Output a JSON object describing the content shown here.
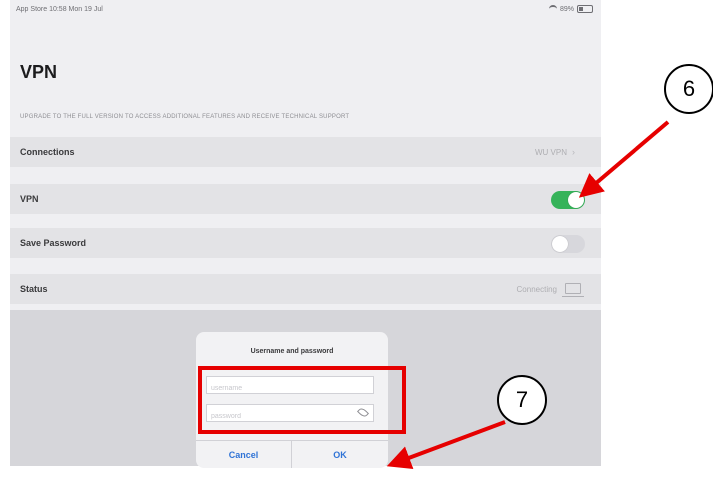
{
  "status_bar": {
    "left_text": "App Store  10:58  Mon 19 Jul",
    "right_text": "89%"
  },
  "page": {
    "title": "VPN",
    "upgrade_note": "UPGRADE TO THE FULL VERSION TO ACCESS ADDITIONAL FEATURES AND RECEIVE TECHNICAL SUPPORT"
  },
  "rows": {
    "connections": {
      "label": "Connections",
      "value": "WU VPN"
    },
    "vpn": {
      "label": "VPN",
      "toggle": "on"
    },
    "save_password": {
      "label": "Save Password",
      "toggle": "off"
    },
    "status": {
      "label": "Status",
      "value": "Connecting"
    }
  },
  "dialog": {
    "title": "Username and password",
    "username_placeholder": "username",
    "password_placeholder": "password",
    "cancel_label": "Cancel",
    "ok_label": "OK"
  },
  "annotations": {
    "callout_6": "6",
    "callout_7": "7",
    "color": "#e60000"
  }
}
